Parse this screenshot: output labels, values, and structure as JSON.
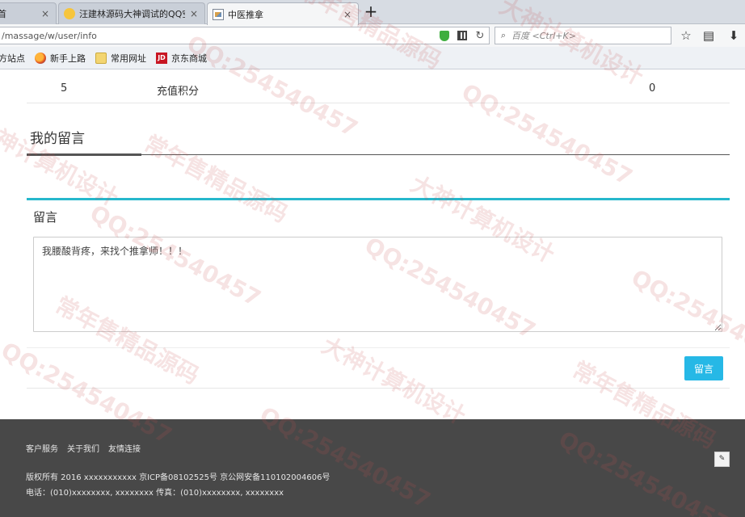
{
  "browser": {
    "tabs": [
      {
        "title": "首",
        "favicon": "page-icon",
        "active": false
      },
      {
        "title": "汪建林源码大神调试的QQ空",
        "favicon": "qq-icon",
        "active": false
      },
      {
        "title": "中医推拿",
        "favicon": "page-icon",
        "active": true
      }
    ],
    "new_tab_symbol": "+",
    "close_symbol": "×",
    "url": "/massage/w/user/info",
    "search_placeholder": "百度 <Ctrl+K>",
    "bookmarks": [
      {
        "label": "方站点",
        "icon": "none"
      },
      {
        "label": "新手上路",
        "icon": "firefox-icon"
      },
      {
        "label": "常用网址",
        "icon": "folder-icon"
      },
      {
        "label": "京东商城",
        "icon": "jd-icon"
      }
    ],
    "jd_badge": "JD"
  },
  "score_row": {
    "index": "5",
    "label": "充值积分",
    "value": "0"
  },
  "messages_section": {
    "title": "我的留言"
  },
  "message_panel": {
    "title": "留言",
    "textarea_value": "我腰酸背疼，来找个推拿师！！！",
    "submit_label": "留言"
  },
  "footer": {
    "links": [
      "客户服务",
      "关于我们",
      "友情连接"
    ],
    "copyright": "版权所有 2016 xxxxxxxxxxx 京ICP备08102525号 京公网安备110102004606号",
    "contact": "电话：(010)xxxxxxxx, xxxxxxxx 传真：(010)xxxxxxxx, xxxxxxxx",
    "icon_label": "✎"
  },
  "watermark": {
    "texts": [
      "常年售精品源码",
      "QQ:254540457",
      "大神计算机设计"
    ]
  },
  "colors": {
    "accent": "#26b8cc",
    "button": "#26b8e6",
    "footer_bg": "#484848"
  }
}
